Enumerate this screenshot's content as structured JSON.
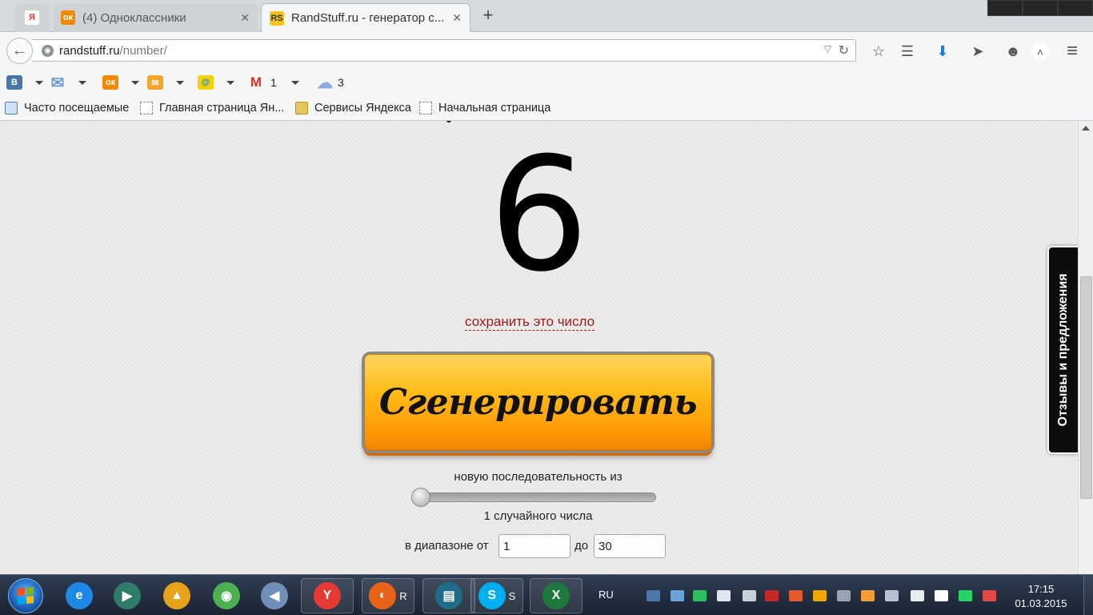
{
  "browser": {
    "tabs": [
      {
        "title": "",
        "favicon": "yandex-icon",
        "active": false
      },
      {
        "title": "(4) Одноклассники",
        "favicon": "odnoklassniki-icon",
        "active": false
      },
      {
        "title": "RandStuff.ru - генератор с...",
        "favicon": "randstuff-icon",
        "active": true
      }
    ],
    "new_tab_symbol": "+",
    "close_symbol": "✕",
    "url_domain": "randstuff.ru",
    "url_path": "/number/",
    "globe_glyph": "◉",
    "reload_glyph": "↻",
    "dropdown_glyph": "▽",
    "back_glyph": "←",
    "nav_icons": [
      "bookmark-star-icon",
      "reading-list-icon",
      "downloads-icon",
      "send-icon",
      "chat-icon",
      "collapse-icon",
      "menu-icon"
    ],
    "nav_glyphs": [
      "☆",
      "☰",
      "⬇",
      "➤",
      "☻",
      "˄",
      "≡"
    ]
  },
  "yandex_toolbar": {
    "items": [
      {
        "icon": "vk-icon",
        "glyph": "В",
        "count": "",
        "color": "#4a76a8"
      },
      {
        "icon": "mail-icon",
        "glyph": "✉",
        "count": "",
        "color": "#6b9bd1"
      },
      {
        "icon": "odnoklassniki-icon",
        "glyph": "ок",
        "count": "",
        "color": "#f28a00"
      },
      {
        "icon": "yandex-mail-icon",
        "glyph": "✉",
        "count": "",
        "color": "#f4a62a"
      },
      {
        "icon": "mailru-icon",
        "glyph": "@",
        "count": "",
        "color": "#168de2"
      },
      {
        "icon": "gmail-icon",
        "glyph": "M",
        "count": "1",
        "color": "#d93025"
      },
      {
        "icon": "weather-cloud-icon",
        "glyph": "☁",
        "count": "3",
        "color": "#8fa9e0"
      }
    ]
  },
  "bookmarks": [
    {
      "label": "Часто посещаемые",
      "icon": "most-visited-icon"
    },
    {
      "label": "Главная страница Ян...",
      "icon": "page-icon"
    },
    {
      "label": "Сервисы Яндекса",
      "icon": "folder-icon"
    },
    {
      "label": "Начальная страница",
      "icon": "page-icon"
    }
  ],
  "page": {
    "generated_number": "6",
    "save_link": "сохранить это число",
    "generate_button": "Сгенерировать",
    "sequence_label": "новую последовательность из",
    "slider_value_fraction": 0.0,
    "count_label": "1 случайного числа",
    "range_from_label": "в диапазоне от",
    "range_to_label": "до",
    "range_from_value": "1",
    "range_to_value": "30",
    "feedback_tab": "Отзывы и предложения"
  },
  "taskbar": {
    "apps": [
      {
        "name": "internet-explorer-icon",
        "glyph": "e",
        "color": "#1e88e5",
        "running": false,
        "label": ""
      },
      {
        "name": "media-player-icon",
        "glyph": "▶",
        "color": "#2e7d6b",
        "running": false,
        "label": ""
      },
      {
        "name": "aimp-icon",
        "glyph": "▲",
        "color": "#e8a21a",
        "running": false,
        "label": ""
      },
      {
        "name": "chrome-icon",
        "glyph": "◉",
        "color": "#4caf50",
        "running": false,
        "label": ""
      },
      {
        "name": "volume-app-icon",
        "glyph": "◀",
        "color": "#6f8fb8",
        "running": false,
        "label": ""
      },
      {
        "name": "yandex-browser-icon",
        "glyph": "Y",
        "color": "#e53935",
        "running": true,
        "label": ""
      },
      {
        "name": "firefox-icon",
        "glyph": "◐",
        "color": "#e8621a",
        "running": true,
        "label": "R"
      },
      {
        "name": "printer-icon",
        "glyph": "▤",
        "color": "#1f6d8a",
        "running": true,
        "label": ""
      },
      {
        "name": "skype-icon",
        "glyph": "S",
        "color": "#00aff0",
        "running": true,
        "label": "S"
      },
      {
        "name": "excel-icon",
        "glyph": "X",
        "color": "#1d7a3e",
        "running": true,
        "label": ""
      }
    ],
    "language": "RU",
    "tray_icons": [
      {
        "name": "vk-tray-icon",
        "color": "#4a76a8"
      },
      {
        "name": "download-tray-icon",
        "color": "#6aa3d8"
      },
      {
        "name": "evernote-tray-icon",
        "color": "#2dbe60"
      },
      {
        "name": "window-tray-icon",
        "color": "#e0e6ee"
      },
      {
        "name": "network-app-tray-icon",
        "color": "#c8d0da"
      },
      {
        "name": "flag-tray-icon",
        "color": "#c62828"
      },
      {
        "name": "speaker-tray-icon",
        "color": "#e35b2c"
      },
      {
        "name": "aimp-tray-icon",
        "color": "#f0a500"
      },
      {
        "name": "display-tray-icon",
        "color": "#9aa4b0"
      },
      {
        "name": "weather-tray-icon",
        "color": "#f29c38"
      },
      {
        "name": "printer-tray-icon",
        "color": "#b9c2cc"
      },
      {
        "name": "battery-tray-icon",
        "color": "#e9eef3"
      },
      {
        "name": "signal-tray-icon",
        "color": "#ffffff"
      },
      {
        "name": "whatsapp-tray-icon",
        "color": "#25d366"
      },
      {
        "name": "mute-tray-icon",
        "color": "#e24a4a"
      }
    ],
    "time": "17:15",
    "date": "01.03.2015"
  }
}
